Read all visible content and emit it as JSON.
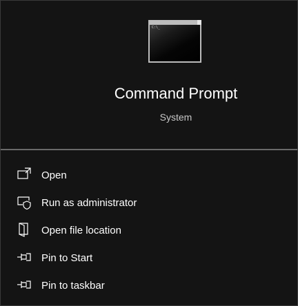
{
  "app": {
    "title": "Command Prompt",
    "subtitle": "System",
    "icon": "command-prompt-icon",
    "icon_glyph": "C:\\_"
  },
  "menu": {
    "items": [
      {
        "label": "Open",
        "icon": "open-icon"
      },
      {
        "label": "Run as administrator",
        "icon": "shield-icon"
      },
      {
        "label": "Open file location",
        "icon": "folder-icon"
      },
      {
        "label": "Pin to Start",
        "icon": "pin-icon"
      },
      {
        "label": "Pin to taskbar",
        "icon": "pin-icon"
      }
    ]
  },
  "colors": {
    "background": "#141414",
    "divider": "#6a6a6a",
    "text": "#ffffff",
    "subtext": "#c8c8c8"
  }
}
